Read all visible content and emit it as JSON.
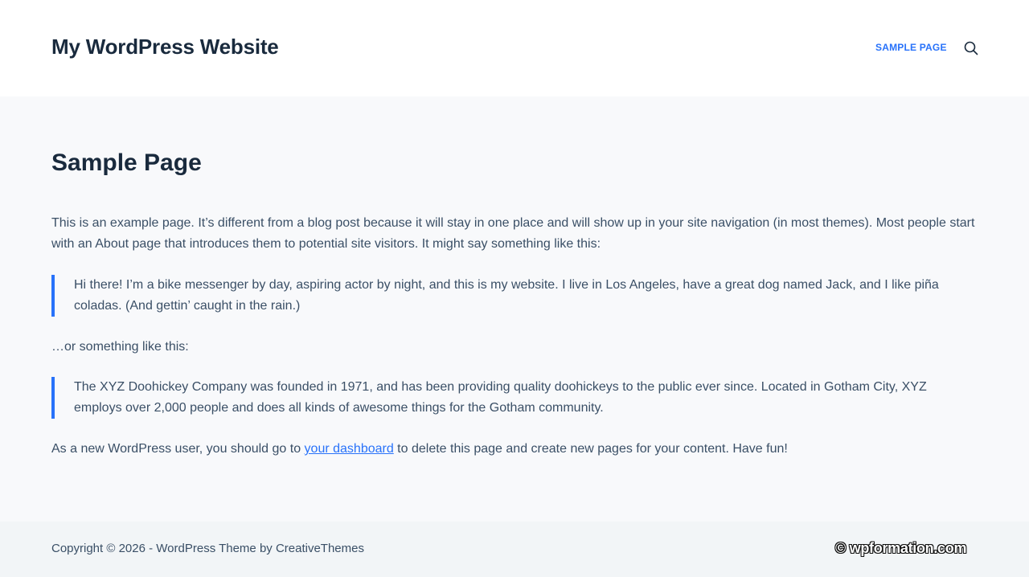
{
  "header": {
    "site_title": "My WordPress Website",
    "nav": [
      {
        "label": "SAMPLE PAGE"
      }
    ],
    "search_icon": "search-icon"
  },
  "main": {
    "title": "Sample Page",
    "intro": "This is an example page. It’s different from a blog post because it will stay in one place and will show up in your site navigation (in most themes). Most people start with an About page that introduces them to potential site visitors. It might say something like this:",
    "quote1": "Hi there! I’m a bike messenger by day, aspiring actor by night, and this is my website. I live in Los Angeles, have a great dog named Jack, and I like piña coladas. (And gettin’ caught in the rain.)",
    "middle": "…or something like this:",
    "quote2": "The XYZ Doohickey Company was founded in 1971, and has been providing quality doohickeys to the public ever since. Located in Gotham City, XYZ employs over 2,000 people and does all kinds of awesome things for the Gotham community.",
    "outro_before": "As a new WordPress user, you should go to ",
    "outro_link": "your dashboard",
    "outro_after": " to delete this page and create new pages for your content. Have fun!"
  },
  "footer": {
    "copyright": "Copyright © 2026 - WordPress Theme by CreativeThemes",
    "watermark": "© wpformation.com"
  },
  "colors": {
    "accent": "#2872fa",
    "heading": "#192a3d",
    "text": "#3a4f66",
    "content_bg": "#f8f9fb",
    "footer_bg": "#f2f5f7"
  }
}
